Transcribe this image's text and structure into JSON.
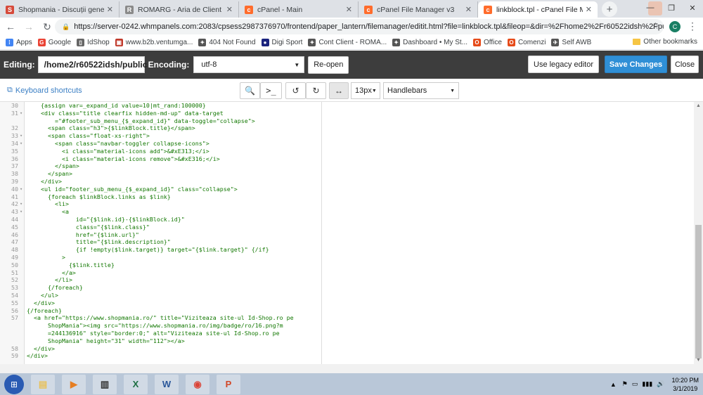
{
  "browser": {
    "tabs": [
      {
        "title": "Shopmania - Discuții generale",
        "icon": "shopmania-icon",
        "color": "#d64a3b",
        "glyph": "S"
      },
      {
        "title": "ROMARG - Aria de Client",
        "icon": "image-icon",
        "color": "#8a8a8a",
        "glyph": "R"
      },
      {
        "title": "cPanel - Main",
        "icon": "cpanel-icon",
        "color": "#ff6c2c",
        "glyph": "c"
      },
      {
        "title": "cPanel File Manager v3",
        "icon": "cpanel-icon",
        "color": "#ff6c2c",
        "glyph": "c"
      },
      {
        "title": "linkblock.tpl - cPanel File Mana",
        "icon": "cpanel-icon",
        "color": "#ff6c2c",
        "glyph": "c"
      }
    ],
    "newtab": "+",
    "url": "https://server-0242.whmpanels.com:2083/cpsess2987376970/frontend/paper_lantern/filemanager/editit.html?file=linkblock.tpl&fileop=&dir=%2Fhome2%2Fr60522idsh%2Fpubli...",
    "profile_initial": "C",
    "bookmarks": [
      {
        "label": "Apps",
        "color": "#4285f4",
        "glyph": "⁞"
      },
      {
        "label": "Google",
        "color": "#ea4335",
        "glyph": "G"
      },
      {
        "label": "IdShop",
        "color": "#666",
        "glyph": "▯"
      },
      {
        "label": "www.b2b.ventumga...",
        "color": "#c0392b",
        "glyph": "▣"
      },
      {
        "label": "404 Not Found",
        "color": "#555",
        "glyph": "✦"
      },
      {
        "label": "Digi Sport",
        "color": "#1a237e",
        "glyph": "●"
      },
      {
        "label": "Cont Client - ROMA...",
        "color": "#555",
        "glyph": "✦"
      },
      {
        "label": "Dashboard • My St...",
        "color": "#555",
        "glyph": "✦"
      },
      {
        "label": "Office",
        "color": "#e64a19",
        "glyph": "O"
      },
      {
        "label": "Comenzi",
        "color": "#e64a19",
        "glyph": "O"
      },
      {
        "label": "Self AWB",
        "color": "#555",
        "glyph": "✈"
      }
    ],
    "other_bookmarks": "Other bookmarks"
  },
  "editbar": {
    "editing_label": "Editing:",
    "path": "/home2/r60522idsh/public",
    "encoding_label": "Encoding:",
    "encoding_value": "utf-8",
    "reopen": "Re-open",
    "legacy": "Use legacy editor",
    "save": "Save Changes",
    "close": "Close"
  },
  "edtoolbar": {
    "shortcuts": "Keyboard shortcuts",
    "font_size": "13px",
    "mode": "Handlebars"
  },
  "code_lines": [
    {
      "n": "30",
      "f": "",
      "t": "    {assign var=_expand_id value=10|mt_rand:100000}"
    },
    {
      "n": "31",
      "f": "▾",
      "t": "    <div class=\"title clearfix hidden-md-up\" data-target"
    },
    {
      "n": "",
      "f": "",
      "t": "        =\"#footer_sub_menu_{$_expand_id}\" data-toggle=\"collapse\">"
    },
    {
      "n": "32",
      "f": "",
      "t": "      <span class=\"h3\">{$linkBlock.title}</span>"
    },
    {
      "n": "33",
      "f": "▾",
      "t": "      <span class=\"float-xs-right\">"
    },
    {
      "n": "34",
      "f": "▾",
      "t": "        <span class=\"navbar-toggler collapse-icons\">"
    },
    {
      "n": "35",
      "f": "",
      "t": "          <i class=\"material-icons add\">&#xE313;</i>"
    },
    {
      "n": "36",
      "f": "",
      "t": "          <i class=\"material-icons remove\">&#xE316;</i>"
    },
    {
      "n": "37",
      "f": "",
      "t": "        </span>"
    },
    {
      "n": "38",
      "f": "",
      "t": "      </span>"
    },
    {
      "n": "39",
      "f": "",
      "t": "    </div>"
    },
    {
      "n": "40",
      "f": "▾",
      "t": "    <ul id=\"footer_sub_menu_{$_expand_id}\" class=\"collapse\">"
    },
    {
      "n": "41",
      "f": "",
      "t": "      {foreach $linkBlock.links as $link}"
    },
    {
      "n": "42",
      "f": "▾",
      "t": "        <li>"
    },
    {
      "n": "43",
      "f": "▾",
      "t": "          <a"
    },
    {
      "n": "44",
      "f": "",
      "t": "              id=\"{$link.id}-{$linkBlock.id}\""
    },
    {
      "n": "45",
      "f": "",
      "t": "              class=\"{$link.class}\""
    },
    {
      "n": "46",
      "f": "",
      "t": "              href=\"{$link.url}\""
    },
    {
      "n": "47",
      "f": "",
      "t": "              title=\"{$link.description}\""
    },
    {
      "n": "48",
      "f": "",
      "t": "              {if !empty($link.target)} target=\"{$link.target}\" {/if}"
    },
    {
      "n": "49",
      "f": "",
      "t": "          >"
    },
    {
      "n": "50",
      "f": "",
      "t": "            {$link.title}"
    },
    {
      "n": "51",
      "f": "",
      "t": "          </a>"
    },
    {
      "n": "52",
      "f": "",
      "t": "        </li>"
    },
    {
      "n": "53",
      "f": "",
      "t": "      {/foreach}"
    },
    {
      "n": "54",
      "f": "",
      "t": "    </ul>"
    },
    {
      "n": "55",
      "f": "",
      "t": "  </div>"
    },
    {
      "n": "56",
      "f": "",
      "t": "{/foreach}"
    },
    {
      "n": "57",
      "f": "",
      "t": "  <a href=\"https://www.shopmania.ro/\" title=\"Viziteaza site-ul Id-Shop.ro pe"
    },
    {
      "n": "",
      "f": "",
      "t": "      ShopMania\"><img src=\"https://www.shopmania.ro/img/badge/ro/16.png?m"
    },
    {
      "n": "",
      "f": "",
      "t": "      =244136916\" style=\"border:0;\" alt=\"Viziteaza site-ul Id-Shop.ro pe"
    },
    {
      "n": "",
      "f": "",
      "t": "      ShopMania\" height=\"31\" width=\"112\"></a>"
    },
    {
      "n": "58",
      "f": "",
      "t": "  </div>"
    },
    {
      "n": "59",
      "f": "",
      "t": "</div>"
    }
  ],
  "taskbar": {
    "apps": [
      {
        "name": "explorer-app",
        "color": "#e8c15a",
        "glyph": "▤"
      },
      {
        "name": "media-player-app",
        "color": "#e67e22",
        "glyph": "▶"
      },
      {
        "name": "terminal-app",
        "color": "#333",
        "glyph": "▥"
      },
      {
        "name": "excel-app",
        "color": "#1d6f42",
        "glyph": "X"
      },
      {
        "name": "word-app",
        "color": "#2b579a",
        "glyph": "W"
      },
      {
        "name": "chrome-app",
        "color": "#db4437",
        "glyph": "◉"
      },
      {
        "name": "powerpoint-app",
        "color": "#d24726",
        "glyph": "P"
      }
    ],
    "time": "10:20 PM",
    "date": "3/1/2019"
  }
}
